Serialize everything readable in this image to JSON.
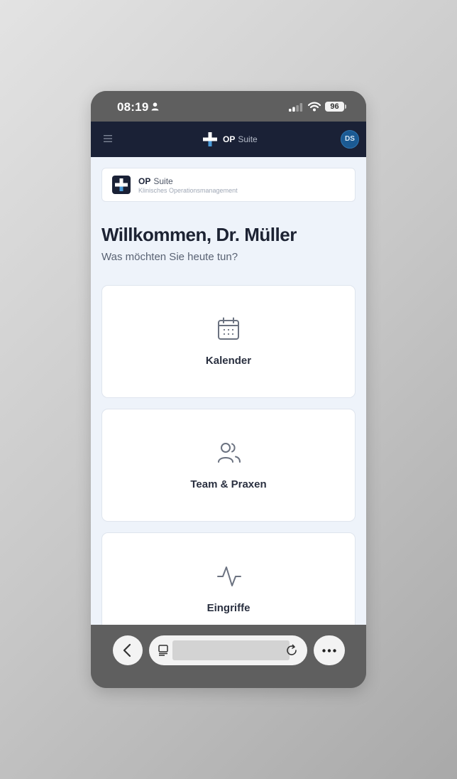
{
  "status_bar": {
    "time": "08:19",
    "battery": "96",
    "icons": [
      "person-icon",
      "signal-icon",
      "wifi-icon",
      "battery-icon"
    ]
  },
  "app_bar": {
    "menu_icon": "menu-icon",
    "brand_op": "OP",
    "brand_suite": "Suite",
    "avatar_initials": "DS",
    "brand_color": "#1a2136",
    "avatar_color": "#1b5a93"
  },
  "brand_card": {
    "title_op": "OP",
    "title_suite": "Suite",
    "subtitle": "Klinisches Operationsmanagement"
  },
  "main": {
    "welcome": "Willkommen, Dr. Müller",
    "subtitle": "Was möchten Sie heute tun?",
    "tiles": [
      {
        "label": "Kalender",
        "icon": "calendar-icon"
      },
      {
        "label": "Team & Praxen",
        "icon": "users-icon"
      },
      {
        "label": "Eingriffe",
        "icon": "activity-icon"
      }
    ]
  },
  "browser_bar": {
    "back_icon": "chevron-left-icon",
    "tabs_icon": "tabs-icon",
    "reload_icon": "reload-icon",
    "more_icon": "more-icon"
  }
}
